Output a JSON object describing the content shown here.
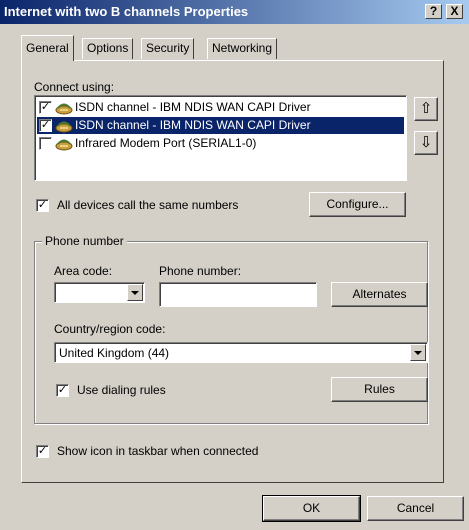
{
  "window": {
    "title": "Internet with two B channels Properties",
    "help_label": "?",
    "close_label": "X"
  },
  "tabs": [
    {
      "label": "General",
      "active": true
    },
    {
      "label": "Options",
      "active": false
    },
    {
      "label": "Security",
      "active": false
    },
    {
      "label": "Networking",
      "active": false
    }
  ],
  "general": {
    "connect_using_label": "Connect using:",
    "devices": [
      {
        "label": "ISDN  channel - IBM NDIS WAN CAPI Driver",
        "checked": true,
        "selected": false,
        "icon": "modem-icon"
      },
      {
        "label": "ISDN  channel - IBM NDIS WAN CAPI Driver",
        "checked": true,
        "selected": true,
        "icon": "modem-icon"
      },
      {
        "label": "Infrared Modem Port (SERIAL1-0)",
        "checked": false,
        "selected": false,
        "icon": "modem-icon"
      }
    ],
    "move_up_label": "⇧",
    "move_down_label": "⇩",
    "all_devices_label": "All devices call the same numbers",
    "all_devices_checked": true,
    "configure_label": "Configure...",
    "phone_group_title": "Phone number",
    "area_code_label": "Area code:",
    "area_code_value": "",
    "phone_number_label": "Phone number:",
    "phone_number_value": "",
    "alternates_label": "Alternates",
    "country_label": "Country/region code:",
    "country_value": "United Kingdom (44)",
    "use_dialing_rules_label": "Use dialing rules",
    "use_dialing_rules_checked": true,
    "rules_label": "Rules",
    "show_icon_label": "Show icon in taskbar when connected",
    "show_icon_checked": true
  },
  "footer": {
    "ok_label": "OK",
    "cancel_label": "Cancel"
  },
  "colors": {
    "titlebar_start": "#0a246a",
    "titlebar_end": "#a6caf0",
    "face": "#d4d0c8",
    "selection": "#0a246a"
  }
}
